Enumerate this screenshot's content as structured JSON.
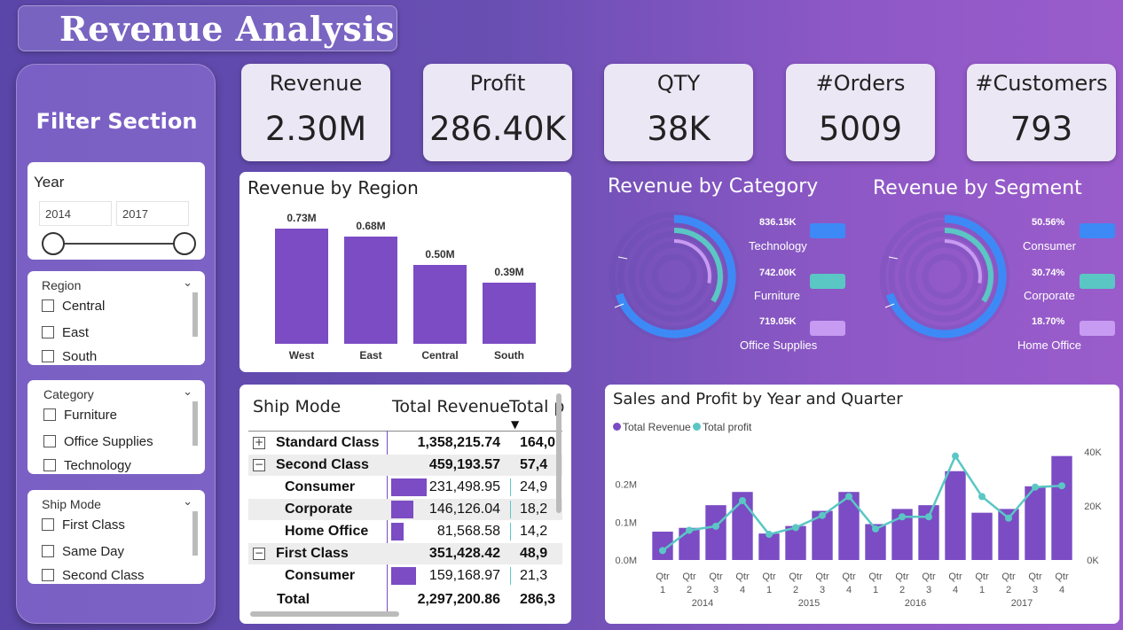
{
  "header": {
    "title": "Revenue Analysis"
  },
  "filters": {
    "title": "Filter Section",
    "year": {
      "label": "Year",
      "from": "2014",
      "to": "2017"
    },
    "region": {
      "label": "Region",
      "items": [
        "Central",
        "East",
        "South"
      ]
    },
    "category": {
      "label": "Category",
      "items": [
        "Furniture",
        "Office Supplies",
        "Technology"
      ]
    },
    "ship_mode": {
      "label": "Ship Mode",
      "items": [
        "First Class",
        "Same Day",
        "Second Class"
      ]
    }
  },
  "kpis": [
    {
      "label": "Revenue",
      "value": "2.30M"
    },
    {
      "label": "Profit",
      "value": "286.40K"
    },
    {
      "label": "QTY",
      "value": "38K"
    },
    {
      "label": "#Orders",
      "value": "5009"
    },
    {
      "label": "#Customers",
      "value": "793"
    }
  ],
  "revenue_by_region": {
    "title": "Revenue by Region",
    "bars": [
      {
        "category": "West",
        "label": "0.73M",
        "value": 0.73
      },
      {
        "category": "East",
        "label": "0.68M",
        "value": 0.68
      },
      {
        "category": "Central",
        "label": "0.50M",
        "value": 0.5
      },
      {
        "category": "South",
        "label": "0.39M",
        "value": 0.39
      }
    ]
  },
  "revenue_by_category": {
    "title": "Revenue by Category",
    "items": [
      {
        "value": "836.15K",
        "name": "Technology",
        "color": "#3d8af7"
      },
      {
        "value": "742.00K",
        "name": "Furniture",
        "color": "#5ac7c4"
      },
      {
        "value": "719.05K",
        "name": "Office Supplies",
        "color": "#c79bf2"
      }
    ]
  },
  "revenue_by_segment": {
    "title": "Revenue by Segment",
    "items": [
      {
        "value": "50.56%",
        "name": "Consumer",
        "color": "#3d8af7"
      },
      {
        "value": "30.74%",
        "name": "Corporate",
        "color": "#5ac7c4"
      },
      {
        "value": "18.70%",
        "name": "Home Office",
        "color": "#c79bf2"
      }
    ]
  },
  "ship_table": {
    "headers": [
      "Ship Mode",
      "Total Revenue",
      "Total p"
    ],
    "rows": [
      {
        "name": "Standard Class",
        "level": 0,
        "expander": "+",
        "revenue": "1,358,215.74",
        "profit": "164,0"
      },
      {
        "name": "Second Class",
        "level": 0,
        "expander": "−",
        "revenue": "459,193.57",
        "profit": "57,4"
      },
      {
        "name": "Consumer",
        "level": 1,
        "revenue": "231,498.95",
        "profit": "24,9"
      },
      {
        "name": "Corporate",
        "level": 1,
        "revenue": "146,126.04",
        "profit": "18,2"
      },
      {
        "name": "Home Office",
        "level": 1,
        "revenue": "81,568.58",
        "profit": "14,2"
      },
      {
        "name": "First Class",
        "level": 0,
        "expander": "−",
        "revenue": "351,428.42",
        "profit": "48,9"
      },
      {
        "name": "Consumer",
        "level": 1,
        "revenue": "159,168.97",
        "profit": "21,3"
      }
    ],
    "total": {
      "name": "Total",
      "revenue": "2,297,200.86",
      "profit": "286,3"
    }
  },
  "chart_data": {
    "type": "bar",
    "title": "Sales and Profit by Year and Quarter",
    "series": [
      {
        "name": "Total Revenue",
        "type": "bar",
        "color": "#7b4cc4",
        "values": [
          0.075,
          0.085,
          0.145,
          0.18,
          0.07,
          0.09,
          0.13,
          0.18,
          0.095,
          0.135,
          0.145,
          0.235,
          0.125,
          0.135,
          0.195,
          0.275
        ]
      },
      {
        "name": "Total profit",
        "type": "line",
        "color": "#5ac7c4",
        "values": [
          3500,
          11000,
          12500,
          22000,
          9500,
          12000,
          16500,
          23500,
          11500,
          16000,
          16000,
          38500,
          23500,
          15500,
          27000,
          27500
        ]
      }
    ],
    "categories": [
      "Qtr 1",
      "Qtr 2",
      "Qtr 3",
      "Qtr 4",
      "Qtr 1",
      "Qtr 2",
      "Qtr 3",
      "Qtr 4",
      "Qtr 1",
      "Qtr 2",
      "Qtr 3",
      "Qtr 4",
      "Qtr 1",
      "Qtr 2",
      "Qtr 3",
      "Qtr 4"
    ],
    "years": [
      "2014",
      "2015",
      "2016",
      "2017"
    ],
    "left_axis": {
      "ticks": [
        "0.0M",
        "0.1M",
        "0.2M"
      ],
      "ylim": [
        0,
        0.3
      ]
    },
    "right_axis": {
      "ticks": [
        "0K",
        "20K",
        "40K"
      ],
      "ylim": [
        0,
        42000
      ]
    },
    "legend": "top-left"
  }
}
